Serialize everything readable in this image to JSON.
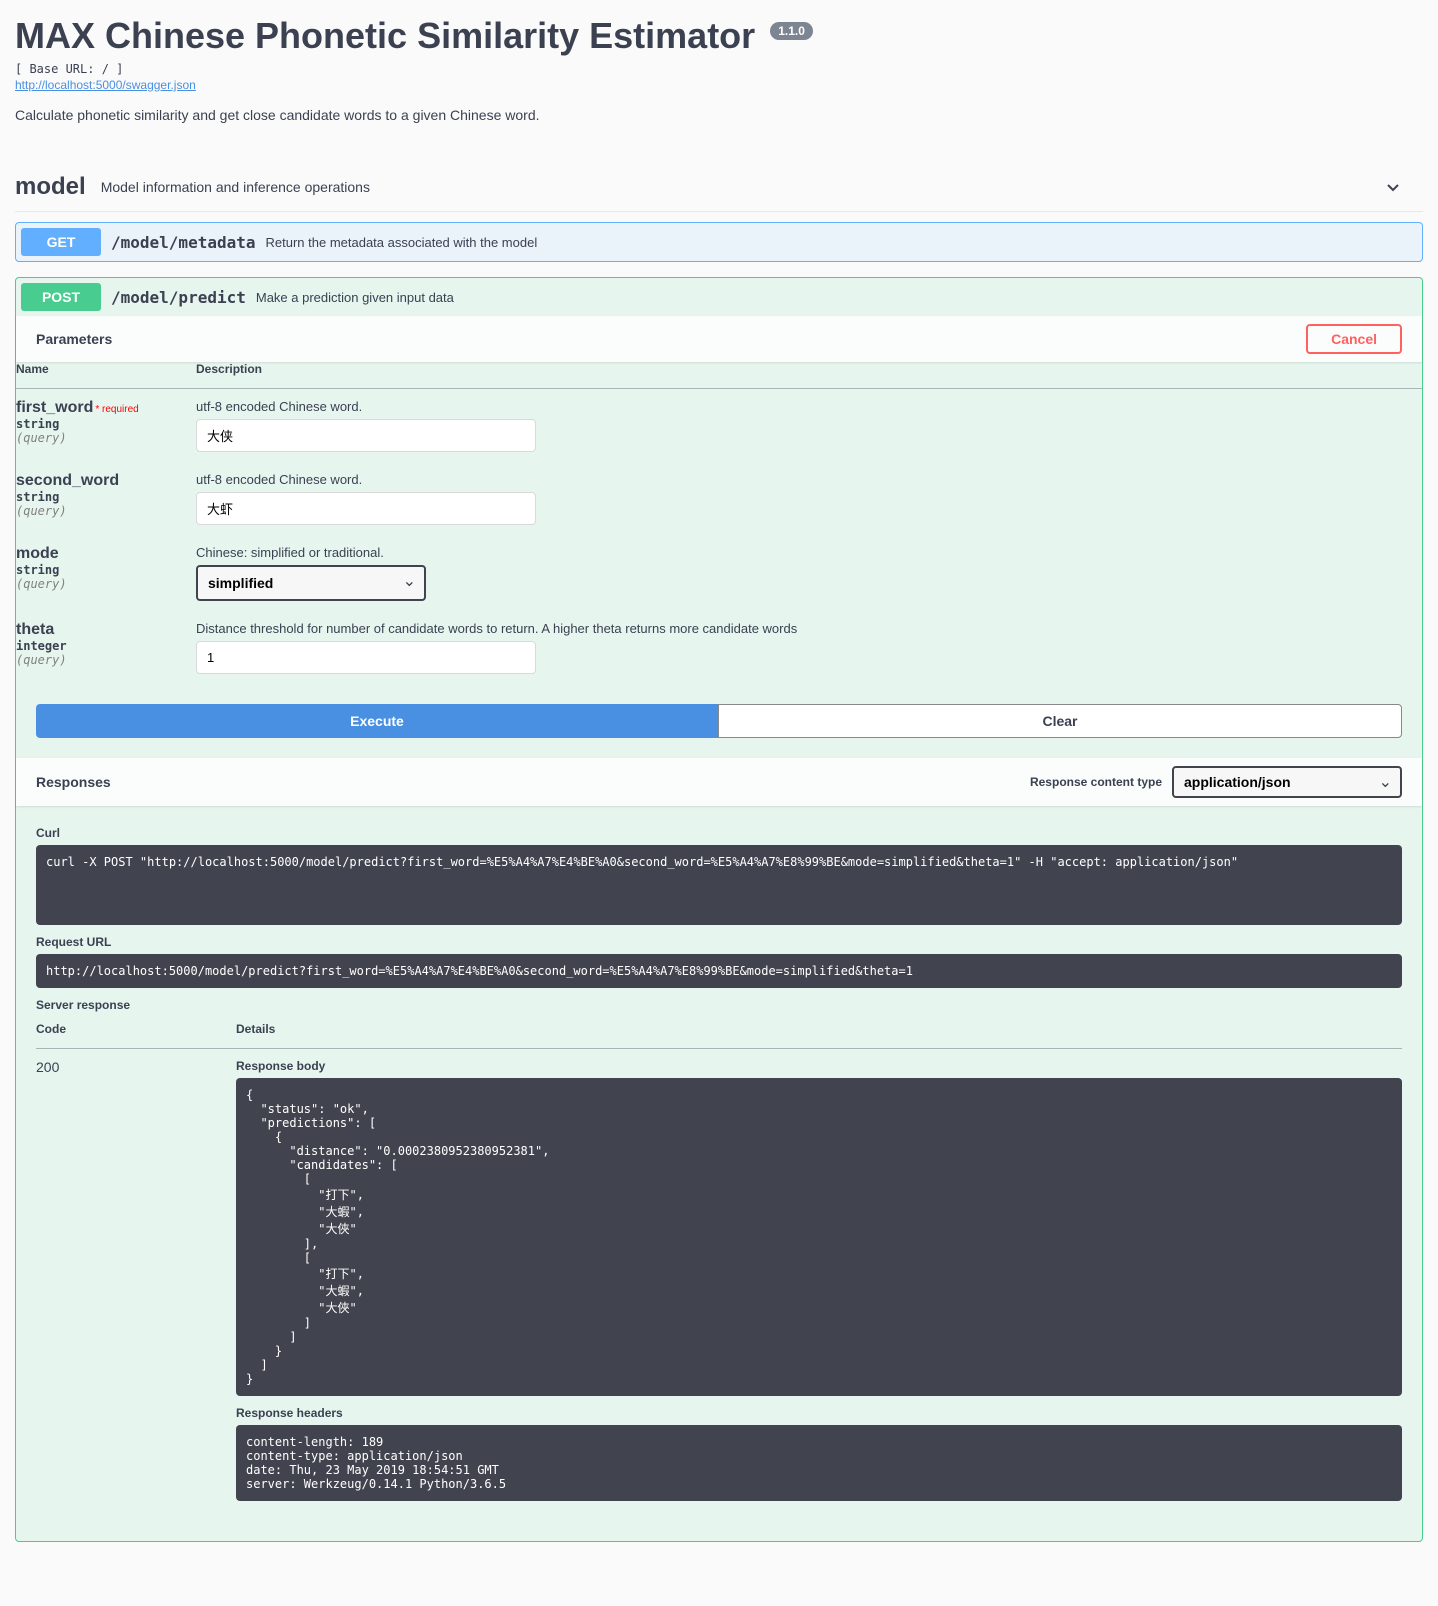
{
  "header": {
    "title": "MAX Chinese Phonetic Similarity Estimator",
    "version": "1.1.0",
    "base_url_label": "[ Base URL: / ]",
    "swagger_url": "http://localhost:5000/swagger.json",
    "description": "Calculate phonetic similarity and get close candidate words to a given Chinese word."
  },
  "tag": {
    "name": "model",
    "description": "Model information and inference operations"
  },
  "ops": {
    "get": {
      "method": "GET",
      "path": "/model/metadata",
      "summary": "Return the metadata associated with the model"
    },
    "post": {
      "method": "POST",
      "path": "/model/predict",
      "summary": "Make a prediction given input data"
    }
  },
  "parameters_header": "Parameters",
  "cancel_label": "Cancel",
  "table_headers": {
    "name": "Name",
    "description": "Description"
  },
  "params": {
    "first_word": {
      "name": "first_word",
      "required_label": "* required",
      "type": "string",
      "in": "(query)",
      "description": "utf-8 encoded Chinese word.",
      "value": "大侠"
    },
    "second_word": {
      "name": "second_word",
      "type": "string",
      "in": "(query)",
      "description": "utf-8 encoded Chinese word.",
      "value": "大虾"
    },
    "mode": {
      "name": "mode",
      "type": "string",
      "in": "(query)",
      "description": "Chinese: simplified or traditional.",
      "value": "simplified"
    },
    "theta": {
      "name": "theta",
      "type": "integer",
      "in": "(query)",
      "description": "Distance threshold for number of candidate words to return. A higher theta returns more candidate words",
      "value": "1"
    }
  },
  "buttons": {
    "execute": "Execute",
    "clear": "Clear"
  },
  "responses": {
    "header": "Responses",
    "content_type_label": "Response content type",
    "content_type_value": "application/json",
    "curl_label": "Curl",
    "curl_value": "curl -X POST \"http://localhost:5000/model/predict?first_word=%E5%A4%A7%E4%BE%A0&second_word=%E5%A4%A7%E8%99%BE&mode=simplified&theta=1\" -H \"accept: application/json\"",
    "request_url_label": "Request URL",
    "request_url_value": "http://localhost:5000/model/predict?first_word=%E5%A4%A7%E4%BE%A0&second_word=%E5%A4%A7%E8%99%BE&mode=simplified&theta=1",
    "server_response_label": "Server response",
    "code_header": "Code",
    "details_header": "Details",
    "code_value": "200",
    "body_label": "Response body",
    "body_value": "{\n  \"status\": \"ok\",\n  \"predictions\": [\n    {\n      \"distance\": \"0.0002380952380952381\",\n      \"candidates\": [\n        [\n          \"打下\",\n          \"大蝦\",\n          \"大俠\"\n        ],\n        [\n          \"打下\",\n          \"大蝦\",\n          \"大俠\"\n        ]\n      ]\n    }\n  ]\n}",
    "headers_label": "Response headers",
    "headers_value": "content-length: 189\ncontent-type: application/json\ndate: Thu, 23 May 2019 18:54:51 GMT\nserver: Werkzeug/0.14.1 Python/3.6.5"
  }
}
